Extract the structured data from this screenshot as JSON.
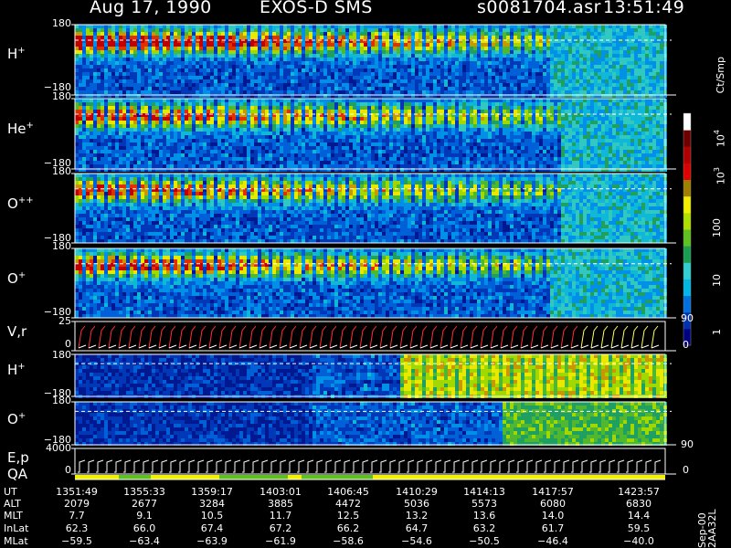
{
  "header": {
    "date": "Aug 17, 1990",
    "mission": "EXOS-D SMS",
    "file": "s0081704.asr",
    "time": "13:51:49"
  },
  "colorbar": {
    "unit": "Ct/Smp",
    "labels": [
      "1",
      "10",
      "100",
      "10",
      "10"
    ],
    "exponents": [
      "",
      "",
      "",
      "3",
      "4"
    ],
    "colors": [
      "#000080",
      "#0030b0",
      "#0070e0",
      "#00b8e8",
      "#30d0d0",
      "#18a050",
      "#60c020",
      "#b0e000",
      "#f0f000",
      "#a08000",
      "#e00000",
      "#b00000",
      "#700000",
      "#ffffff"
    ]
  },
  "chart_data": [
    {
      "type": "heatmap",
      "panel": "H+",
      "label_main": "H",
      "label_sup": "+",
      "yticks": [
        "180",
        "−180"
      ],
      "ylim": [
        -180,
        180
      ]
    },
    {
      "type": "heatmap",
      "panel": "He+",
      "label_main": "He",
      "label_sup": "+",
      "yticks": [
        "180",
        "−180"
      ],
      "ylim": [
        -180,
        180
      ]
    },
    {
      "type": "heatmap",
      "panel": "O++",
      "label_main": "O",
      "label_sup": "++",
      "yticks": [
        "180",
        "−180"
      ],
      "ylim": [
        -180,
        180
      ]
    },
    {
      "type": "heatmap",
      "panel": "O+",
      "label_main": "O",
      "label_sup": "+",
      "yticks": [
        "180",
        "−180"
      ],
      "ylim": [
        -180,
        180
      ]
    },
    {
      "type": "line",
      "panel": "V,r",
      "label_main": "V,r",
      "yticks": [
        "25",
        "0"
      ],
      "right_ticks": [
        "90",
        "0"
      ]
    },
    {
      "type": "heatmap",
      "panel": "H+ (2)",
      "label_main": "H",
      "label_sup": "+",
      "yticks": [
        "180",
        "−180"
      ],
      "ylim": [
        -180,
        180
      ]
    },
    {
      "type": "heatmap",
      "panel": "O+ (2)",
      "label_main": "O",
      "label_sup": "+",
      "yticks": [
        "180",
        "−180"
      ],
      "ylim": [
        -180,
        180
      ],
      "right_ticks": [
        "90"
      ]
    },
    {
      "type": "line",
      "panel": "E,p QA",
      "label_main": "E,p",
      "label_second": "QA",
      "yticks": [
        "4000",
        "0"
      ],
      "right_ticks": [
        "0"
      ]
    }
  ],
  "table": {
    "row_labels": [
      "UT",
      "ALT",
      "MLT",
      "InLat",
      "MLat"
    ],
    "columns": [
      [
        "1351:49",
        "2079",
        "7.7",
        "62.3",
        "−59.5"
      ],
      [
        "1355:33",
        "2677",
        "9.1",
        "66.0",
        "−63.4"
      ],
      [
        "1359:17",
        "3284",
        "10.5",
        "67.4",
        "−63.9"
      ],
      [
        "1403:01",
        "3885",
        "11.7",
        "67.2",
        "−61.9"
      ],
      [
        "1406:45",
        "4472",
        "12.5",
        "66.2",
        "−58.6"
      ],
      [
        "1410:29",
        "5036",
        "13.2",
        "64.7",
        "−54.6"
      ],
      [
        "1414:13",
        "5573",
        "13.6",
        "63.2",
        "−50.5"
      ],
      [
        "1417:57",
        "6080",
        "14.0",
        "61.7",
        "−46.4"
      ],
      [
        "1423:57",
        "6830",
        "14.4",
        "59.5",
        "−40.0"
      ]
    ],
    "footer": "Sep-00  2AA32L"
  }
}
